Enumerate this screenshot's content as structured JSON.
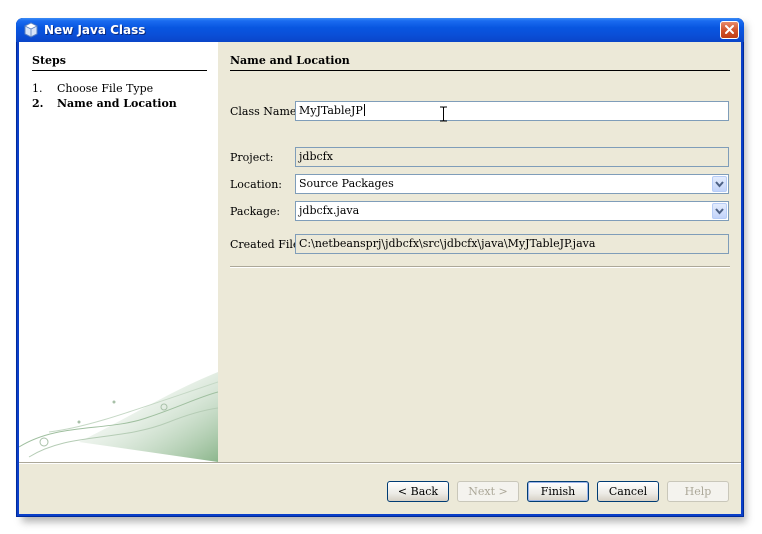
{
  "window": {
    "title": "New Java Class"
  },
  "steps": {
    "title": "Steps",
    "items": [
      {
        "num": "1.",
        "label": "Choose File Type"
      },
      {
        "num": "2.",
        "label": "Name and Location"
      }
    ]
  },
  "panel": {
    "title": "Name and Location"
  },
  "form": {
    "class_name_label": "Class Name:",
    "class_name_value": "MyJTableJP",
    "project_label": "Project:",
    "project_value": "jdbcfx",
    "location_label": "Location:",
    "location_value": "Source Packages",
    "package_label": "Package:",
    "package_value": "jdbcfx.java",
    "created_file_label": "Created File:",
    "created_file_value": "C:\\netbeansprj\\jdbcfx\\src\\jdbcfx\\java\\MyJTableJP.java"
  },
  "buttons": {
    "back": "< Back",
    "next": "Next >",
    "finish": "Finish",
    "cancel": "Cancel",
    "help": "Help"
  }
}
